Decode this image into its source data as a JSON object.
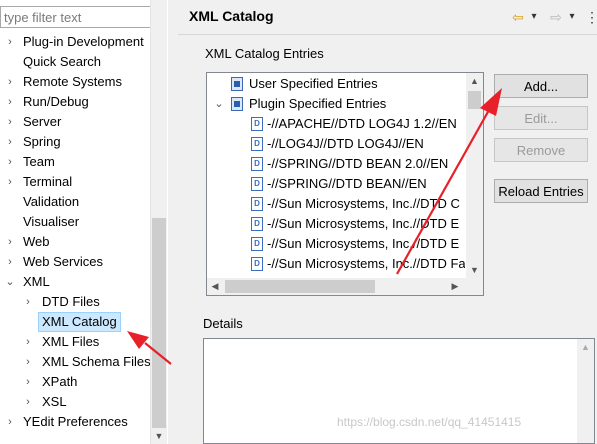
{
  "left_pane": {
    "filter_placeholder": "type filter text",
    "items": [
      {
        "label": "Plug-in Development",
        "arrow": "›",
        "level": 0
      },
      {
        "label": "Quick Search",
        "arrow": "",
        "level": 0
      },
      {
        "label": "Remote Systems",
        "arrow": "›",
        "level": 0
      },
      {
        "label": "Run/Debug",
        "arrow": "›",
        "level": 0
      },
      {
        "label": "Server",
        "arrow": "›",
        "level": 0
      },
      {
        "label": "Spring",
        "arrow": "›",
        "level": 0
      },
      {
        "label": "Team",
        "arrow": "›",
        "level": 0
      },
      {
        "label": "Terminal",
        "arrow": "›",
        "level": 0
      },
      {
        "label": "Validation",
        "arrow": "",
        "level": 0
      },
      {
        "label": "Visualiser",
        "arrow": "",
        "level": 0
      },
      {
        "label": "Web",
        "arrow": "›",
        "level": 0
      },
      {
        "label": "Web Services",
        "arrow": "›",
        "level": 0
      },
      {
        "label": "XML",
        "arrow": "⌄",
        "level": 0
      },
      {
        "label": "DTD Files",
        "arrow": "›",
        "level": 1
      },
      {
        "label": "XML Catalog",
        "arrow": "",
        "level": 1,
        "selected": true
      },
      {
        "label": "XML Files",
        "arrow": "›",
        "level": 1
      },
      {
        "label": "XML Schema Files",
        "arrow": "›",
        "level": 1
      },
      {
        "label": "XPath",
        "arrow": "›",
        "level": 1
      },
      {
        "label": "XSL",
        "arrow": "›",
        "level": 1
      },
      {
        "label": "YEdit Preferences",
        "arrow": "›",
        "level": 0
      }
    ]
  },
  "page": {
    "title": "XML Catalog",
    "nav": {
      "back": "⇦",
      "back_menu": "▾",
      "forward": "⇨",
      "forward_menu": "▾",
      "view_menu": "⋮"
    }
  },
  "entries_group": {
    "label": "XML Catalog Entries",
    "tree": [
      {
        "label": "User Specified Entries",
        "arrow": "",
        "level": 0,
        "icon": "catalog-icon"
      },
      {
        "label": "Plugin Specified Entries",
        "arrow": "⌄",
        "level": 0,
        "icon": "catalog-icon"
      },
      {
        "label": "-//APACHE//DTD LOG4J 1.2//EN",
        "level": 1,
        "icon": "dtd-file-icon"
      },
      {
        "label": "-//LOG4J//DTD LOG4J//EN",
        "level": 1,
        "icon": "dtd-file-icon"
      },
      {
        "label": "-//SPRING//DTD BEAN 2.0//EN",
        "level": 1,
        "icon": "dtd-file-icon"
      },
      {
        "label": "-//SPRING//DTD BEAN//EN",
        "level": 1,
        "icon": "dtd-file-icon"
      },
      {
        "label": "-//Sun Microsystems, Inc.//DTD C",
        "level": 1,
        "icon": "dtd-file-icon"
      },
      {
        "label": "-//Sun Microsystems, Inc.//DTD E",
        "level": 1,
        "icon": "dtd-file-icon"
      },
      {
        "label": "-//Sun Microsystems, Inc.//DTD E",
        "level": 1,
        "icon": "dtd-file-icon"
      },
      {
        "label": "-//Sun Microsystems, Inc.//DTD Fa",
        "level": 1,
        "icon": "dtd-file-icon"
      }
    ],
    "buttons": {
      "add": "Add...",
      "edit": "Edit...",
      "remove": "Remove",
      "reload": "Reload Entries"
    }
  },
  "details_group": {
    "label": "Details"
  },
  "watermark": "https://blog.csdn.net/qq_41451415",
  "colors": {
    "selection_bg": "#cce8ff",
    "annotation_arrow": "#e8202a"
  }
}
